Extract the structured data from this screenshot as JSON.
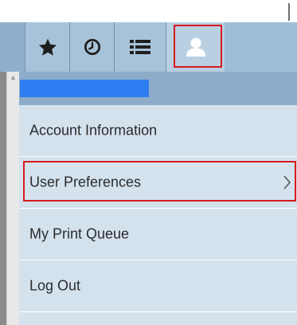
{
  "toolbar": {
    "buttons": [
      {
        "icon": "star-icon",
        "active": false
      },
      {
        "icon": "clock-icon",
        "active": false
      },
      {
        "icon": "list-icon",
        "active": false
      },
      {
        "icon": "user-icon",
        "active": true
      }
    ]
  },
  "menu": {
    "items": [
      {
        "label": "Account Information"
      },
      {
        "label": "User Preferences",
        "has_submenu": true,
        "highlighted": true
      },
      {
        "label": "My Print Queue"
      },
      {
        "label": "Log Out"
      }
    ]
  },
  "colors": {
    "toolbar": "#a7c3da",
    "subheader": "#8cacc9",
    "menu_bg": "#d4e2ee",
    "highlight_border": "#d71920",
    "name_bar": "#2f7df3"
  }
}
